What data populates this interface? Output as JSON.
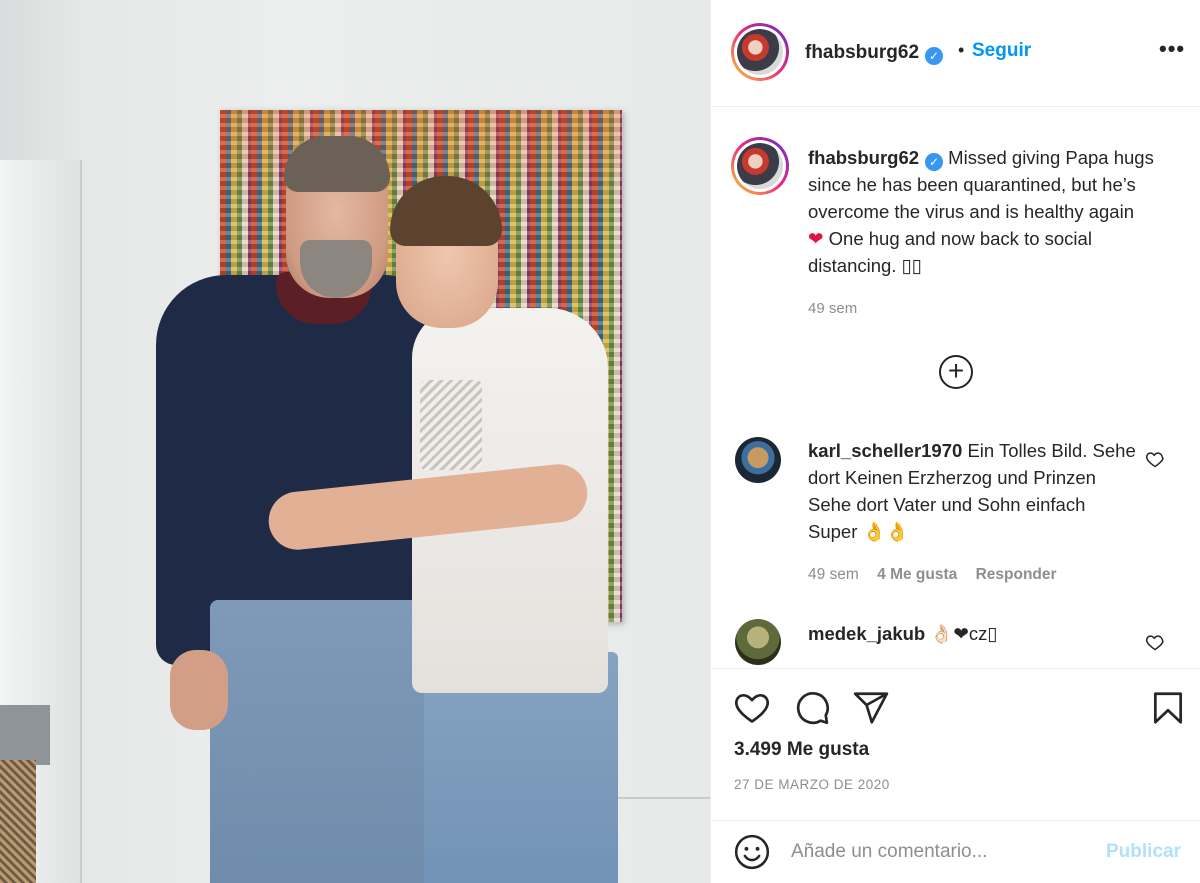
{
  "post": {
    "username": "fhabsburg62",
    "verified_badge": "✓",
    "separator": "•",
    "follow_label": "Seguir",
    "more_label": "•••",
    "caption": "Missed giving Papa hugs since he has been quarantined, but he’s overcome the virus and is healthy again",
    "caption_heart": "❤",
    "caption_tail": "One hug and now back to social distancing. ▯▯",
    "caption_time": "49 sem",
    "load_more_label": "+",
    "likes": "3.499 Me gusta",
    "date": "27 DE MARZO DE 2020",
    "icons": [
      "heart-icon",
      "comment-icon",
      "share-icon",
      "bookmark-icon",
      "emoji-icon",
      "plus-circle-icon"
    ],
    "accent_color": "#0095f6",
    "heart_color": "#e0153d"
  },
  "comments": [
    {
      "username": "karl_scheller1970",
      "text": "Ein Tolles Bild. Sehe dort Keinen Erzherzog und Prinzen Sehe dort Vater und Sohn einfach Super",
      "emoji": "👌👌",
      "time": "49 sem",
      "likes": "4 Me gusta",
      "reply": "Responder"
    },
    {
      "username": "medek_jakub",
      "text": "👌🏻❤cz▯",
      "emoji": ""
    }
  ],
  "composer": {
    "placeholder": "Añade un comentario...",
    "publish_label": "Publicar"
  }
}
